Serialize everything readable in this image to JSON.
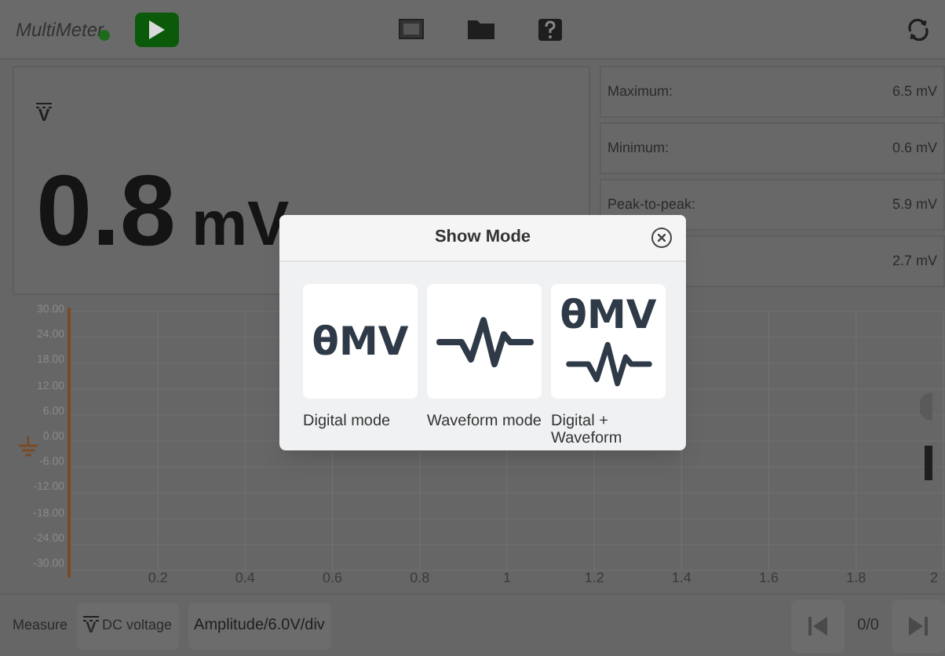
{
  "app": {
    "title": "MultiMeter",
    "running": true
  },
  "display": {
    "mode_symbol": "V",
    "value": "0.8",
    "unit": "mV"
  },
  "readings": [
    {
      "label": "Maximum:",
      "value": "6.5 mV"
    },
    {
      "label": "Minimum:",
      "value": "0.6 mV"
    },
    {
      "label": "Peak-to-peak:",
      "value": "5.9 mV"
    },
    {
      "value": "2.7 mV"
    }
  ],
  "chart": {
    "y_ticks": [
      "30.00",
      "24.00",
      "18.00",
      "12.00",
      "6.00",
      "0.00",
      "-6.00",
      "-12.00",
      "-18.00",
      "-24.00",
      "-30.00"
    ],
    "x_ticks": [
      "0.2",
      "0.4",
      "0.6",
      "0.8",
      "1",
      "1.2",
      "1.4",
      "1.6",
      "1.8",
      "2"
    ]
  },
  "bottom_bar": {
    "measure_label": "Measure",
    "function_symbol": "V",
    "function": "DC voltage",
    "amplitude": "Amplitude/6.0V/div",
    "counter": "0/0"
  },
  "dialog": {
    "title": "Show Mode",
    "options": [
      {
        "kind": "digital",
        "symbol": "θMV",
        "label": "Digital mode"
      },
      {
        "kind": "waveform",
        "label": "Waveform mode"
      },
      {
        "kind": "both",
        "symbol": "θMV",
        "label": "Digital + Waveform"
      }
    ]
  }
}
